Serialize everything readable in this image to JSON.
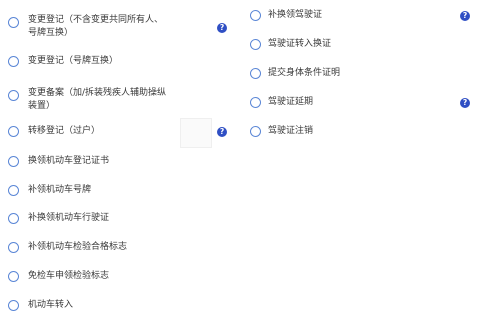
{
  "left_options": [
    {
      "label": "变更登记（不含变更共同所有人、\n号牌互换）",
      "help": true
    },
    {
      "label": "变更登记（号牌互换）",
      "help": false
    },
    {
      "label": "变更备案（加/拆装残疾人辅助操纵\n装置）",
      "help": false
    },
    {
      "label": "转移登记（过户）",
      "help": true
    },
    {
      "label": "换领机动车登记证书",
      "help": false
    },
    {
      "label": "补领机动车号牌",
      "help": false
    },
    {
      "label": "补换领机动车行驶证",
      "help": false
    },
    {
      "label": "补领机动车检验合格标志",
      "help": false
    },
    {
      "label": "免检车申领检验标志",
      "help": false
    },
    {
      "label": "机动车转入",
      "help": false
    }
  ],
  "right_options": [
    {
      "label": "补换领驾驶证",
      "help": true
    },
    {
      "label": "驾驶证转入换证",
      "help": false
    },
    {
      "label": "提交身体条件证明",
      "help": false
    },
    {
      "label": "驾驶证延期",
      "help": true
    },
    {
      "label": "驾驶证注销",
      "help": false
    }
  ],
  "help_icon_glyph": "?",
  "colors": {
    "radio": "#5a86d6",
    "help": "#2f4fc4"
  }
}
